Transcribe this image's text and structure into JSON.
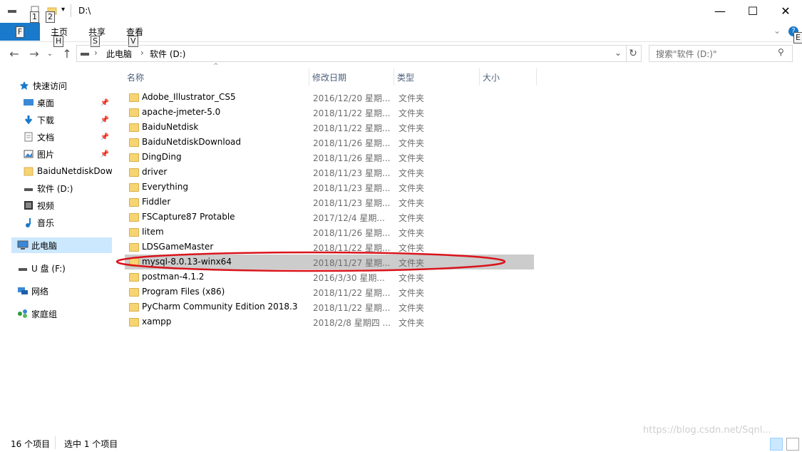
{
  "titlebar": {
    "path": "D:\\",
    "keytips": [
      "1",
      "2"
    ],
    "minimize": "—",
    "maximize": "☐",
    "close": "✕"
  },
  "ribbon": {
    "file_keytip": "F",
    "tabs": [
      {
        "label": "主页",
        "keytip": "H"
      },
      {
        "label": "共享",
        "keytip": "S"
      },
      {
        "label": "查看",
        "keytip": "V"
      }
    ],
    "help_keytip": "E"
  },
  "address": {
    "crumbs": [
      "此电脑",
      "软件 (D:)"
    ],
    "search_placeholder": "搜索\"软件 (D:)\""
  },
  "sidebar": {
    "items": [
      {
        "label": "快速访问",
        "icon": "star-icon"
      },
      {
        "label": "桌面",
        "icon": "desktop-icon",
        "pinned": true
      },
      {
        "label": "下载",
        "icon": "download-icon",
        "pinned": true
      },
      {
        "label": "文档",
        "icon": "document-icon",
        "pinned": true
      },
      {
        "label": "图片",
        "icon": "picture-icon",
        "pinned": true
      },
      {
        "label": "BaiduNetdiskDow",
        "icon": "folder-icon"
      },
      {
        "label": "软件 (D:)",
        "icon": "drive-icon"
      },
      {
        "label": "视频",
        "icon": "video-icon"
      },
      {
        "label": "音乐",
        "icon": "music-icon"
      },
      {
        "label": "此电脑",
        "icon": "pc-icon",
        "selected": true
      },
      {
        "label": "U 盘 (F:)",
        "icon": "usb-icon"
      },
      {
        "label": "网络",
        "icon": "network-icon"
      },
      {
        "label": "家庭组",
        "icon": "homegroup-icon"
      }
    ]
  },
  "columns": [
    "名称",
    "修改日期",
    "类型",
    "大小"
  ],
  "files": [
    {
      "name": "Adobe_Illustrator_CS5",
      "date": "2016/12/20 星期...",
      "type": "文件夹"
    },
    {
      "name": "apache-jmeter-5.0",
      "date": "2018/11/22 星期...",
      "type": "文件夹"
    },
    {
      "name": "BaiduNetdisk",
      "date": "2018/11/22 星期...",
      "type": "文件夹"
    },
    {
      "name": "BaiduNetdiskDownload",
      "date": "2018/11/26 星期...",
      "type": "文件夹"
    },
    {
      "name": "DingDing",
      "date": "2018/11/26 星期...",
      "type": "文件夹"
    },
    {
      "name": "driver",
      "date": "2018/11/23 星期...",
      "type": "文件夹"
    },
    {
      "name": "Everything",
      "date": "2018/11/23 星期...",
      "type": "文件夹"
    },
    {
      "name": "Fiddler",
      "date": "2018/11/23 星期...",
      "type": "文件夹"
    },
    {
      "name": "FSCapture87 Protable",
      "date": "2017/12/4 星期...",
      "type": "文件夹"
    },
    {
      "name": "Iitem",
      "date": "2018/11/26 星期...",
      "type": "文件夹"
    },
    {
      "name": "LDSGameMaster",
      "date": "2018/11/22 星期...",
      "type": "文件夹"
    },
    {
      "name": "mysql-8.0.13-winx64",
      "date": "2018/11/27 星期...",
      "type": "文件夹",
      "selected": true
    },
    {
      "name": "postman-4.1.2",
      "date": "2016/3/30 星期...",
      "type": "文件夹"
    },
    {
      "name": "Program Files (x86)",
      "date": "2018/11/22 星期...",
      "type": "文件夹"
    },
    {
      "name": "PyCharm Community Edition 2018.3",
      "date": "2018/11/22 星期...",
      "type": "文件夹"
    },
    {
      "name": "xampp",
      "date": "2018/2/8 星期四 ...",
      "type": "文件夹"
    }
  ],
  "status": {
    "count": "16 个项目",
    "selection": "选中 1 个项目",
    "watermark": "https://blog.csdn.net/Sqnl..."
  },
  "colors": {
    "accent": "#1979ca",
    "selected_row": "#cccccc",
    "annotation": "#d9141c"
  }
}
